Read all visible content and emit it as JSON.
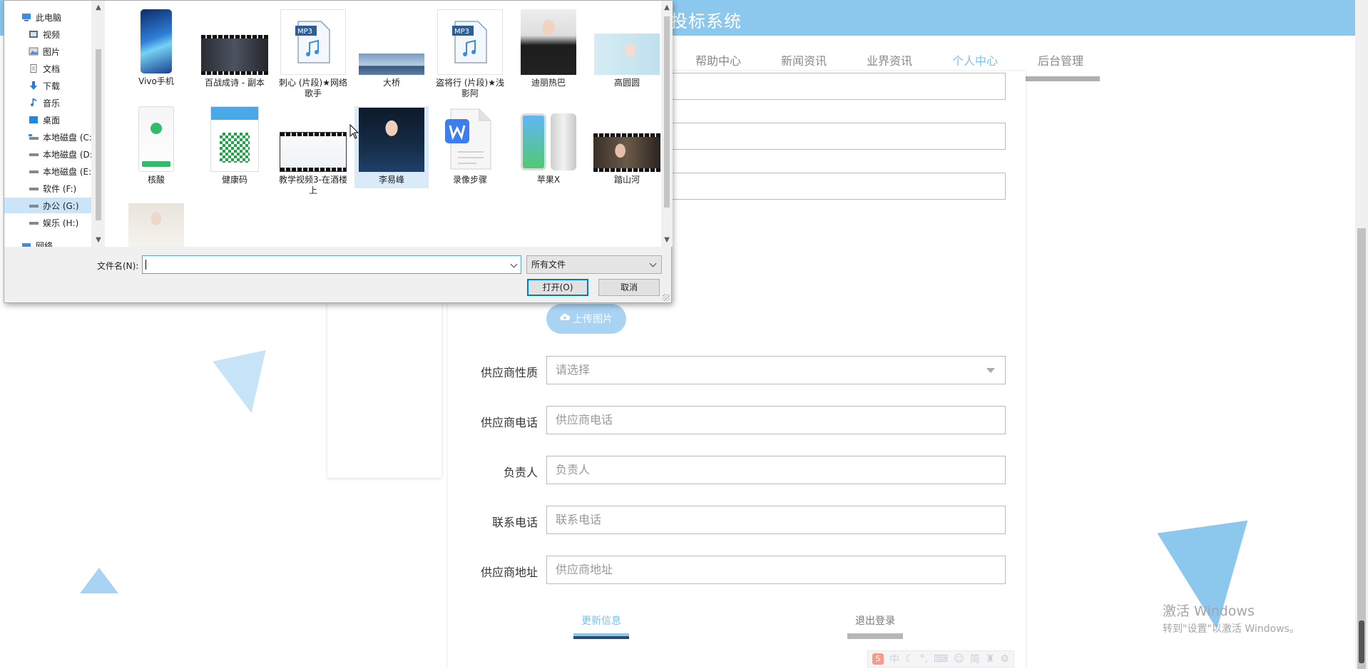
{
  "site": {
    "title": "投标系统",
    "nav": [
      {
        "label": "帮助中心",
        "active": false
      },
      {
        "label": "新闻资讯",
        "active": false
      },
      {
        "label": "业界资讯",
        "active": false
      },
      {
        "label": "个人中心",
        "active": true
      },
      {
        "label": "后台管理",
        "active": false
      }
    ]
  },
  "form": {
    "upload_label": "上传图片",
    "fields": [
      {
        "label": "供应商性质",
        "placeholder": "请选择",
        "type": "select"
      },
      {
        "label": "供应商电话",
        "placeholder": "供应商电话",
        "type": "text"
      },
      {
        "label": "负责人",
        "placeholder": "负责人",
        "type": "text"
      },
      {
        "label": "联系电话",
        "placeholder": "联系电话",
        "type": "text"
      },
      {
        "label": "供应商地址",
        "placeholder": "供应商地址",
        "type": "text"
      }
    ],
    "update_label": "更新信息",
    "logout_label": "退出登录"
  },
  "watermark": {
    "line1": "激活 Windows",
    "line2": "转到\"设置\"以激活 Windows。"
  },
  "ime": {
    "mode": "中",
    "simp": "简"
  },
  "dialog": {
    "tree": [
      {
        "label": "此电脑",
        "icon": "computer-icon",
        "selected": false
      },
      {
        "label": "视频",
        "icon": "video-folder-icon",
        "selected": false
      },
      {
        "label": "图片",
        "icon": "picture-folder-icon",
        "selected": false
      },
      {
        "label": "文档",
        "icon": "document-folder-icon",
        "selected": false
      },
      {
        "label": "下载",
        "icon": "download-icon",
        "selected": false
      },
      {
        "label": "音乐",
        "icon": "music-icon",
        "selected": false
      },
      {
        "label": "桌面",
        "icon": "desktop-icon",
        "selected": false
      },
      {
        "label": "本地磁盘 (C:",
        "icon": "drive-icon",
        "selected": false
      },
      {
        "label": "本地磁盘 (D:",
        "icon": "drive-icon",
        "selected": false
      },
      {
        "label": "本地磁盘 (E:",
        "icon": "drive-icon",
        "selected": false
      },
      {
        "label": "软件 (F:)",
        "icon": "drive-icon",
        "selected": false
      },
      {
        "label": "办公 (G:)",
        "icon": "drive-icon",
        "selected": true
      },
      {
        "label": "娱乐 (H:)",
        "icon": "drive-icon",
        "selected": false
      },
      {
        "label": "网络",
        "icon": "network-icon",
        "selected": false
      }
    ],
    "files": [
      {
        "name": "Vivo手机",
        "kind": "phone"
      },
      {
        "name": "百战成诗 - 副本",
        "kind": "video"
      },
      {
        "name": "刺心 (片段)★网络歌手",
        "kind": "mp3"
      },
      {
        "name": "大桥",
        "kind": "landscape"
      },
      {
        "name": "盗将行 (片段)★浅影阿",
        "kind": "mp3"
      },
      {
        "name": "迪丽热巴",
        "kind": "portrait"
      },
      {
        "name": "高圆圆",
        "kind": "portrait-light"
      },
      {
        "name": "核酸",
        "kind": "app-green"
      },
      {
        "name": "健康码",
        "kind": "qr"
      },
      {
        "name": "教学视频3-在酒楼上",
        "kind": "video-slide"
      },
      {
        "name": "李易峰",
        "kind": "portrait-dark"
      },
      {
        "name": "录像步骤",
        "kind": "wps-doc"
      },
      {
        "name": "苹果X",
        "kind": "iphone"
      },
      {
        "name": "踏山河",
        "kind": "video"
      },
      {
        "name": "",
        "kind": "portrait-light"
      }
    ],
    "filename_label": "文件名(N):",
    "filename_value": "",
    "filetype": "所有文件",
    "open_label": "打开(O)",
    "cancel_label": "取消"
  }
}
